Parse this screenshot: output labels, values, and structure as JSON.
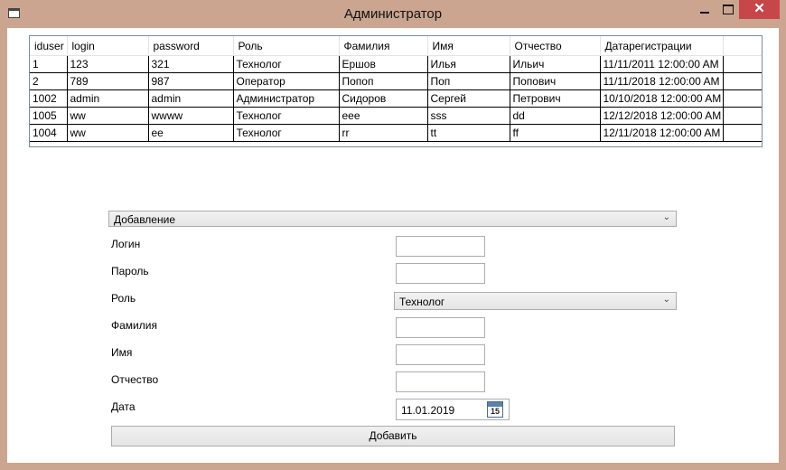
{
  "window": {
    "title": "Администратор"
  },
  "table": {
    "headers": [
      "iduser",
      "login",
      "password",
      "Роль",
      "Фамилия",
      "Имя",
      "Отчество",
      "Датарегистрации"
    ],
    "rows": [
      [
        "1",
        "123",
        "321",
        "Технолог",
        "Ершов",
        "Илья",
        "Ильич",
        "11/11/2011 12:00:00 AM"
      ],
      [
        "2",
        "789",
        "987",
        "Оператор",
        "Попоп",
        "Поп",
        "Попович",
        "11/11/2018 12:00:00 AM"
      ],
      [
        "1002",
        "admin",
        "admin",
        "Администратор",
        "Сидоров",
        "Сергей",
        "Петрович",
        "10/10/2018 12:00:00 AM"
      ],
      [
        "1005",
        "ww",
        "wwww",
        "Технолог",
        "eee",
        "sss",
        "dd",
        "12/12/2018 12:00:00 AM"
      ],
      [
        "1004",
        "ww",
        "ee",
        "Технолог",
        "rr",
        "tt",
        "ff",
        "12/11/2018 12:00:00 AM"
      ]
    ]
  },
  "form": {
    "mode_selected": "Добавление",
    "labels": {
      "login": "Логин",
      "password": "Пароль",
      "role": "Роль",
      "surname": "Фамилия",
      "name": "Имя",
      "patronymic": "Отчество",
      "date": "Дата"
    },
    "values": {
      "login": "",
      "password": "",
      "surname": "",
      "name": "",
      "patronymic": ""
    },
    "role_selected": "Технолог",
    "date_value": "11.01.2019",
    "calendar_day": "15",
    "submit_label": "Добавить"
  }
}
